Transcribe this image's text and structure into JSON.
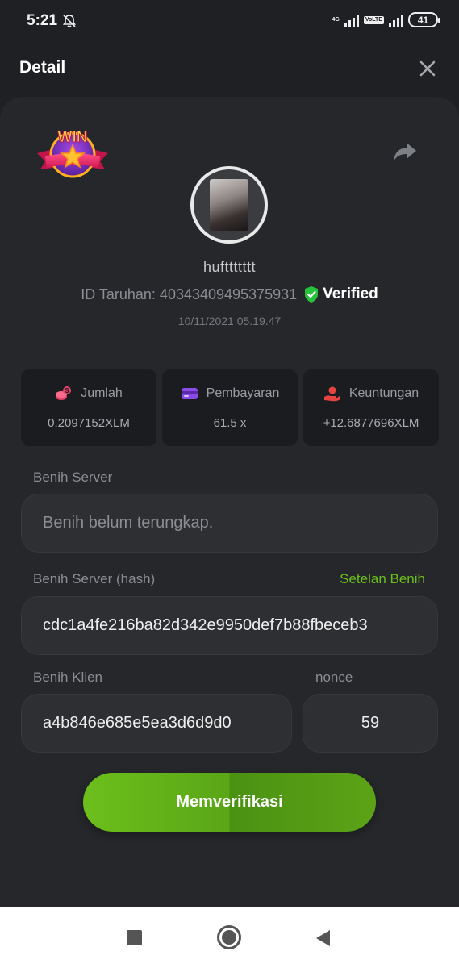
{
  "status_bar": {
    "time": "5:21",
    "network_tag": "4G",
    "lte_tag": "VoLTE",
    "battery": "41"
  },
  "header": {
    "title": "Detail",
    "close_icon": "close-icon"
  },
  "bet": {
    "badge": "WIN",
    "username": "hufttttttt",
    "id_text": "ID Taruhan: 40343409495375931",
    "verified": "Verified",
    "datetime": "10/11/2021 05.19.47"
  },
  "stats": [
    {
      "label": "Jumlah",
      "value": "0.2097152XLM",
      "icon": "coins-icon",
      "color": "#e8436a"
    },
    {
      "label": "Pembayaran",
      "value": "61.5 x",
      "icon": "card-icon",
      "color": "#8a4be8"
    },
    {
      "label": "Keuntungan",
      "value": "+12.6877696XLM",
      "icon": "profit-hand-icon",
      "color": "#e84343"
    }
  ],
  "seeds": {
    "server_label": "Benih Server",
    "server_placeholder": "Benih belum terungkap.",
    "server_hash_label": "Benih Server (hash)",
    "seed_settings_link": "Setelan Benih",
    "server_hash_value": "cdc1a4fe216ba82d342e9950def7b88fbeceb3",
    "client_label": "Benih Klien",
    "client_value": "a4b846e685e5ea3d6d9d0",
    "nonce_label": "nonce",
    "nonce_value": "59"
  },
  "actions": {
    "verify_label": "Memverifikasi"
  },
  "colors": {
    "accent_green": "#6bbf1a",
    "background": "#1e2024",
    "card": "#25272b"
  }
}
